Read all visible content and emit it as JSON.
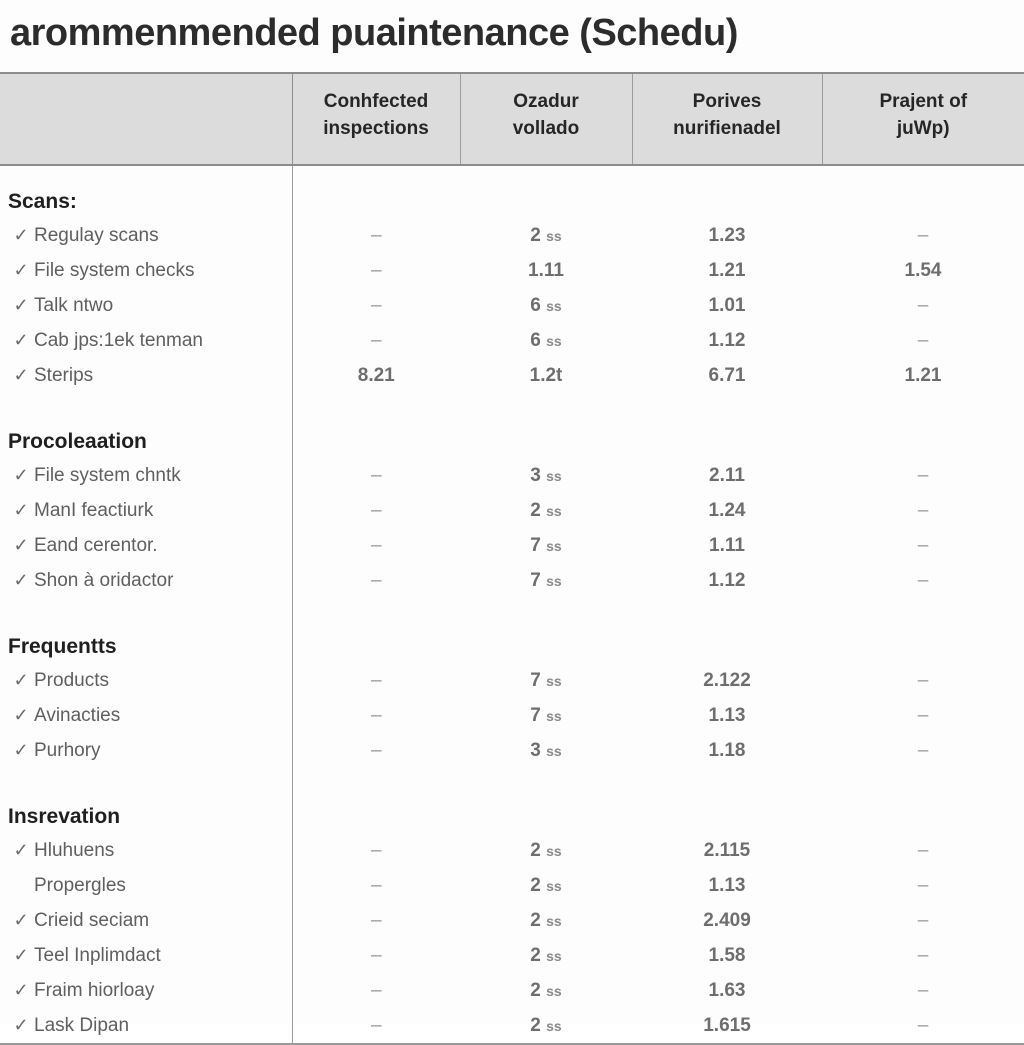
{
  "document": {
    "title": "arommenmended puaintenance (Schedu)"
  },
  "table": {
    "columns": [
      {
        "key": "label",
        "header": ""
      },
      {
        "key": "col1",
        "header_line1": "Conhfected",
        "header_line2": "inspections"
      },
      {
        "key": "col2",
        "header_line1": "Ozadur",
        "header_line2": "vollado"
      },
      {
        "key": "col3",
        "header_line1": "Porives",
        "header_line2": "nurifienadel"
      },
      {
        "key": "col4",
        "header_line1": "Prajent of",
        "header_line2": "juWp)"
      }
    ],
    "check_glyph": "✓",
    "dash_glyph": "–",
    "groups": [
      {
        "title": "Scans:",
        "rows": [
          {
            "checked": true,
            "label": "Regulay scans",
            "col1": "–",
            "col2": "2 ss",
            "col3": "1.23",
            "col4": "–"
          },
          {
            "checked": true,
            "label": "File  system checks",
            "col1": "–",
            "col2": "1.11",
            "col3": "1.21",
            "col4": "1.54"
          },
          {
            "checked": true,
            "label": "Talk ntwo",
            "col1": "–",
            "col2": "6 ss",
            "col3": "1.01",
            "col4": "–"
          },
          {
            "checked": true,
            "label": "Cab jps:1ek tenman",
            "col1": "–",
            "col2": "6 ss",
            "col3": "1.12",
            "col4": "–"
          },
          {
            "checked": true,
            "label": "Sterips",
            "col1": "8.21",
            "col2": "1.2t",
            "col3": "6.71",
            "col4": "1.21"
          }
        ]
      },
      {
        "title": "Procoleaation",
        "rows": [
          {
            "checked": true,
            "label": "File system chntk",
            "col1": "–",
            "col2": "3 ss",
            "col3": "2.11",
            "col4": "–"
          },
          {
            "checked": true,
            "label": "ManI feactiurk",
            "col1": "–",
            "col2": "2 ss",
            "col3": "1.24",
            "col4": "–"
          },
          {
            "checked": true,
            "label": "Eand cerentor.",
            "col1": "–",
            "col2": "7 ss",
            "col3": "1.11",
            "col4": "–"
          },
          {
            "checked": true,
            "label": "Shon à oridactor",
            "col1": "–",
            "col2": "7 ss",
            "col3": "1.12",
            "col4": "–"
          }
        ]
      },
      {
        "title": "Frequentts",
        "rows": [
          {
            "checked": true,
            "label": "Products",
            "col1": "–",
            "col2": "7 ss",
            "col3": "2.122",
            "col4": "–"
          },
          {
            "checked": true,
            "label": "Avinacties",
            "col1": "–",
            "col2": "7 ss",
            "col3": "1.13",
            "col4": "–"
          },
          {
            "checked": true,
            "label": "Purhory",
            "col1": "–",
            "col2": "3 ss",
            "col3": "1.18",
            "col4": "–"
          }
        ]
      },
      {
        "title": "Insrevation",
        "rows": [
          {
            "checked": true,
            "label": "Hluhuens",
            "col1": "–",
            "col2": "2 ss",
            "col3": "2.115",
            "col4": "–"
          },
          {
            "checked": false,
            "label": "Propergles",
            "col1": "–",
            "col2": "2 ss",
            "col3": "1.13",
            "col4": "–"
          },
          {
            "checked": true,
            "label": "Crieid seciam",
            "col1": "–",
            "col2": "2 ss",
            "col3": "2.409",
            "col4": "–"
          },
          {
            "checked": true,
            "label": "Teel Inplimdact",
            "col1": "–",
            "col2": "2 ss",
            "col3": "1.58",
            "col4": "–"
          },
          {
            "checked": true,
            "label": "Fraim hiorloay",
            "col1": "–",
            "col2": "2 ss",
            "col3": "1.63",
            "col4": "–"
          },
          {
            "checked": true,
            "label": "Lask Dipan",
            "col1": "–",
            "col2": "2 ss",
            "col3": "1.615",
            "col4": "–"
          }
        ]
      }
    ]
  },
  "colors": {
    "header_bg": "#dcdcdc",
    "rule": "#8d8d8d",
    "title_text": "#2c2c2c",
    "group_text": "#1f1f1f",
    "body_text": "#6f6f6f"
  }
}
